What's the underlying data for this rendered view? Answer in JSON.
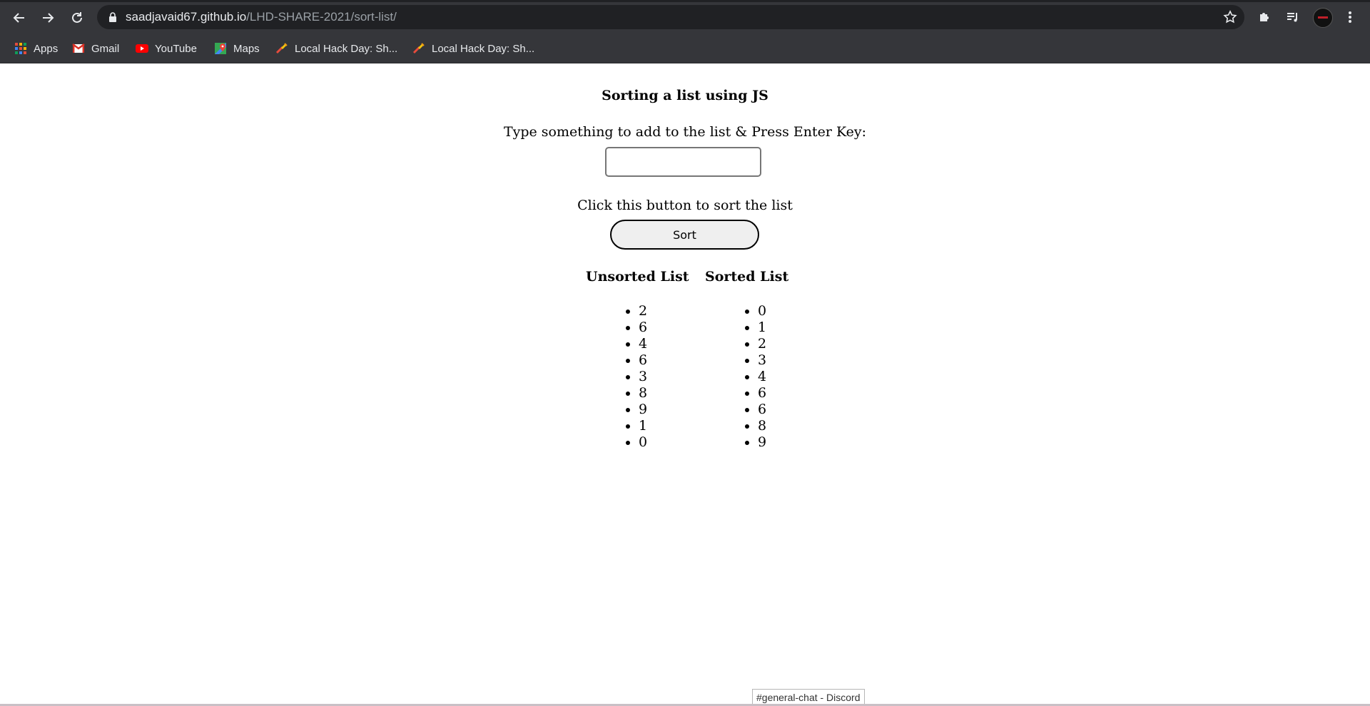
{
  "browser": {
    "url_host": "saadjavaid67.github.io",
    "url_path": "/LHD-SHARE-2021/sort-list/",
    "bookmarks": [
      {
        "label": "Apps",
        "icon": "apps-grid-icon"
      },
      {
        "label": "Gmail",
        "icon": "gmail-icon"
      },
      {
        "label": "YouTube",
        "icon": "youtube-icon"
      },
      {
        "label": "Maps",
        "icon": "maps-icon"
      },
      {
        "label": "Local Hack Day: Sh...",
        "icon": "mlh-icon"
      },
      {
        "label": "Local Hack Day: Sh...",
        "icon": "mlh-icon"
      }
    ]
  },
  "page": {
    "title": "Sorting a list using JS",
    "add_prompt": "Type something to add to the list & Press Enter Key:",
    "add_input_value": "",
    "sort_prompt": "Click this button to sort the list",
    "sort_button": "Sort",
    "unsorted_heading": "Unsorted List",
    "sorted_heading": "Sorted List",
    "unsorted": [
      "2",
      "6",
      "4",
      "6",
      "3",
      "8",
      "9",
      "1",
      "0"
    ],
    "sorted": [
      "0",
      "1",
      "2",
      "3",
      "4",
      "6",
      "6",
      "8",
      "9"
    ]
  },
  "status_tooltip": "#general-chat - Discord",
  "colors": {
    "chrome_bg": "#35363a",
    "omnibox_bg": "#202124",
    "page_bg": "#ffffff"
  }
}
